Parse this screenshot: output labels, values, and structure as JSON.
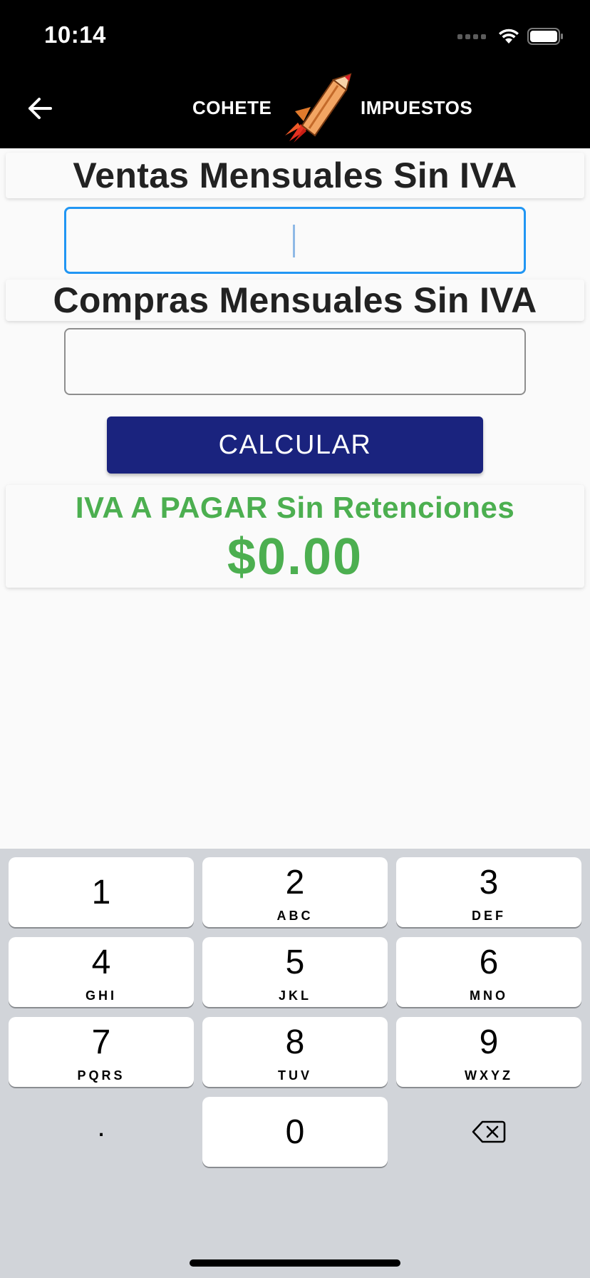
{
  "status_bar": {
    "time": "10:14"
  },
  "app_bar": {
    "back_icon": "arrow-left-icon",
    "title_left": "COHETE",
    "title_right": "IMPUESTOS",
    "logo": "rocket-pencil-logo"
  },
  "form": {
    "sales_label": "Ventas Mensuales Sin IVA",
    "sales_value": "",
    "purchases_label": "Compras Mensuales Sin IVA",
    "purchases_value": "",
    "calculate_label": "CALCULAR"
  },
  "result": {
    "label": "IVA A PAGAR Sin Retenciones",
    "value": "$0.00"
  },
  "keypad": {
    "keys": [
      {
        "digit": "1",
        "letters": ""
      },
      {
        "digit": "2",
        "letters": "ABC"
      },
      {
        "digit": "3",
        "letters": "DEF"
      },
      {
        "digit": "4",
        "letters": "GHI"
      },
      {
        "digit": "5",
        "letters": "JKL"
      },
      {
        "digit": "6",
        "letters": "MNO"
      },
      {
        "digit": "7",
        "letters": "PQRS"
      },
      {
        "digit": "8",
        "letters": "TUV"
      },
      {
        "digit": "9",
        "letters": "WXYZ"
      },
      {
        "digit": "0",
        "letters": ""
      }
    ],
    "decimal": ".",
    "delete_icon": "backspace-icon"
  },
  "colors": {
    "app_bar": "#000000",
    "button": "#1a237e",
    "result_text": "#4caf50",
    "focus_border": "#2196f3"
  }
}
